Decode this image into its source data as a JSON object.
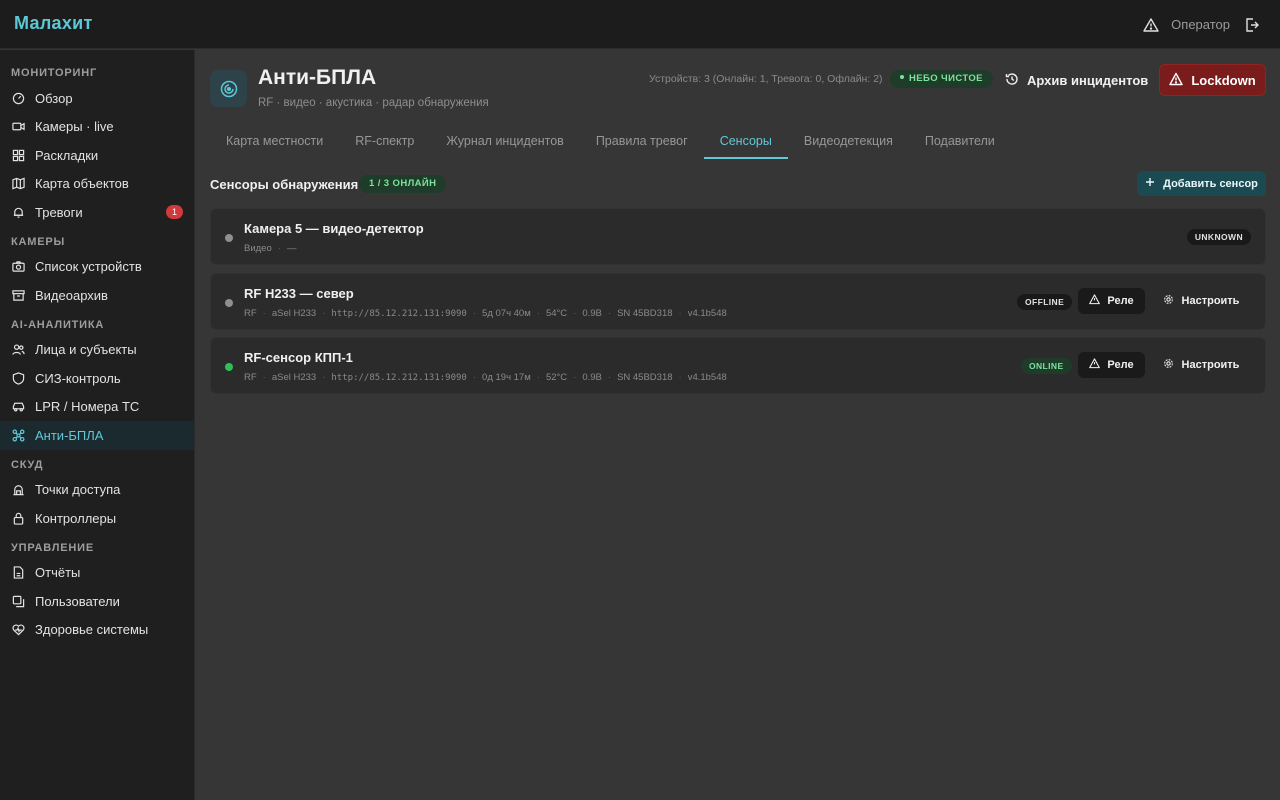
{
  "app": {
    "brand": "Малахит",
    "user": "Оператор"
  },
  "sidebar": {
    "sections": [
      {
        "title": "МОНИТОРИНГ",
        "items": [
          {
            "label": "Обзор",
            "icon": "gauge-icon"
          },
          {
            "label": "Камеры · live",
            "icon": "video-icon"
          },
          {
            "label": "Раскладки",
            "icon": "grid-icon"
          },
          {
            "label": "Карта объектов",
            "icon": "map-icon"
          },
          {
            "label": "Тревоги",
            "icon": "bell-icon",
            "badge": "1"
          }
        ]
      },
      {
        "title": "КАМЕРЫ",
        "items": [
          {
            "label": "Список устройств",
            "icon": "camera-icon"
          },
          {
            "label": "Видеоархив",
            "icon": "archive-icon"
          }
        ]
      },
      {
        "title": "AI-АНАЛИТИКА",
        "items": [
          {
            "label": "Лица и субъекты",
            "icon": "users-icon"
          },
          {
            "label": "СИЗ-контроль",
            "icon": "shield-icon"
          },
          {
            "label": "LPR / Номера ТС",
            "icon": "car-icon"
          },
          {
            "label": "Анти-БПЛА",
            "icon": "drone-icon",
            "active": true
          }
        ]
      },
      {
        "title": "СКУД",
        "items": [
          {
            "label": "Точки доступа",
            "icon": "door-icon"
          },
          {
            "label": "Контроллеры",
            "icon": "lock-icon"
          }
        ]
      },
      {
        "title": "УПРАВЛЕНИЕ",
        "items": [
          {
            "label": "Отчёты",
            "icon": "report-icon"
          },
          {
            "label": "Пользователи",
            "icon": "user-copy-icon"
          },
          {
            "label": "Здоровье системы",
            "icon": "heart-pulse-icon"
          }
        ]
      }
    ]
  },
  "header": {
    "title": "Анти-БПЛА",
    "subtitle": "RF · видео · акустика · радар обнаружения",
    "devices": "Устройств: 3 (Онлайн: 1, Тревога: 0, Офлайн: 2)",
    "sky_status": "НЕБО ЧИСТОЕ",
    "archive_label": "Архив инцидентов",
    "lockdown_label": "Lockdown"
  },
  "tabs": [
    {
      "label": "Карта местности"
    },
    {
      "label": "RF-спектр"
    },
    {
      "label": "Журнал инцидентов"
    },
    {
      "label": "Правила тревог"
    },
    {
      "label": "Сенсоры",
      "active": true
    },
    {
      "label": "Видеодетекция"
    },
    {
      "label": "Подавители"
    }
  ],
  "sensors": {
    "title": "Сенсоры обнаружения",
    "online_badge": "1 / 3 ОНЛАЙН",
    "add_label": "Добавить сенсор",
    "relay_label": "Реле",
    "config_label": "Настроить",
    "items": [
      {
        "name": "Камера 5 — видео-детектор",
        "type": "Видео",
        "model": "—",
        "status": "UNKNOWN"
      },
      {
        "name": "RF H233 — север",
        "type": "RF",
        "model": "aSel H233",
        "url": "http://85.12.212.131:9090",
        "uptime": "5д 07ч 40м",
        "temp": "54°C",
        "voltage": "0.9В",
        "serial": "SN 45BD318",
        "version": "v4.1b548",
        "status": "OFFLINE"
      },
      {
        "name": "RF-сенсор КПП-1",
        "type": "RF",
        "model": "aSel H233",
        "url": "http://85.12.212.131:9090",
        "uptime": "0д 19ч 17м",
        "temp": "52°C",
        "voltage": "0.9В",
        "serial": "SN 45BD318",
        "version": "v4.1b548",
        "status": "ONLINE"
      }
    ]
  },
  "colors": {
    "accent": "#62c8d8",
    "online": "#2fbf5a",
    "danger": "#7a1c1c",
    "background": "#363636"
  }
}
